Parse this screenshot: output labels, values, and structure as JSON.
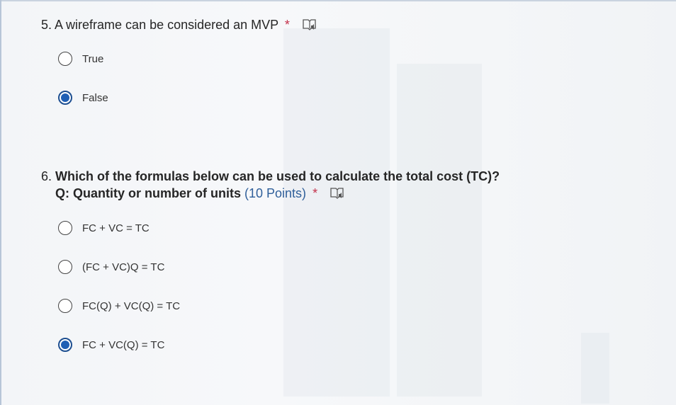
{
  "questions": [
    {
      "number": "5.",
      "text": "A wireframe can be considered an MVP",
      "required_mark": "*",
      "icon": "immersive-reader-icon",
      "options": [
        {
          "label": "True",
          "selected": false
        },
        {
          "label": "False",
          "selected": true
        }
      ]
    },
    {
      "number": "6.",
      "text_line1": "Which of the formulas below can be used to calculate the total cost (TC)?",
      "text_line2": "Q: Quantity or number of units",
      "points": "(10 Points)",
      "required_mark": "*",
      "icon": "immersive-reader-icon",
      "options": [
        {
          "label": "FC + VC = TC",
          "selected": false
        },
        {
          "label": "(FC + VC)Q = TC",
          "selected": false
        },
        {
          "label": "FC(Q) + VC(Q) = TC",
          "selected": false
        },
        {
          "label": "FC + VC(Q) = TC",
          "selected": true
        }
      ]
    }
  ],
  "colors": {
    "selected_radio": "#1f5fb4",
    "required": "#c4314b",
    "points": "#2f5f9a"
  }
}
